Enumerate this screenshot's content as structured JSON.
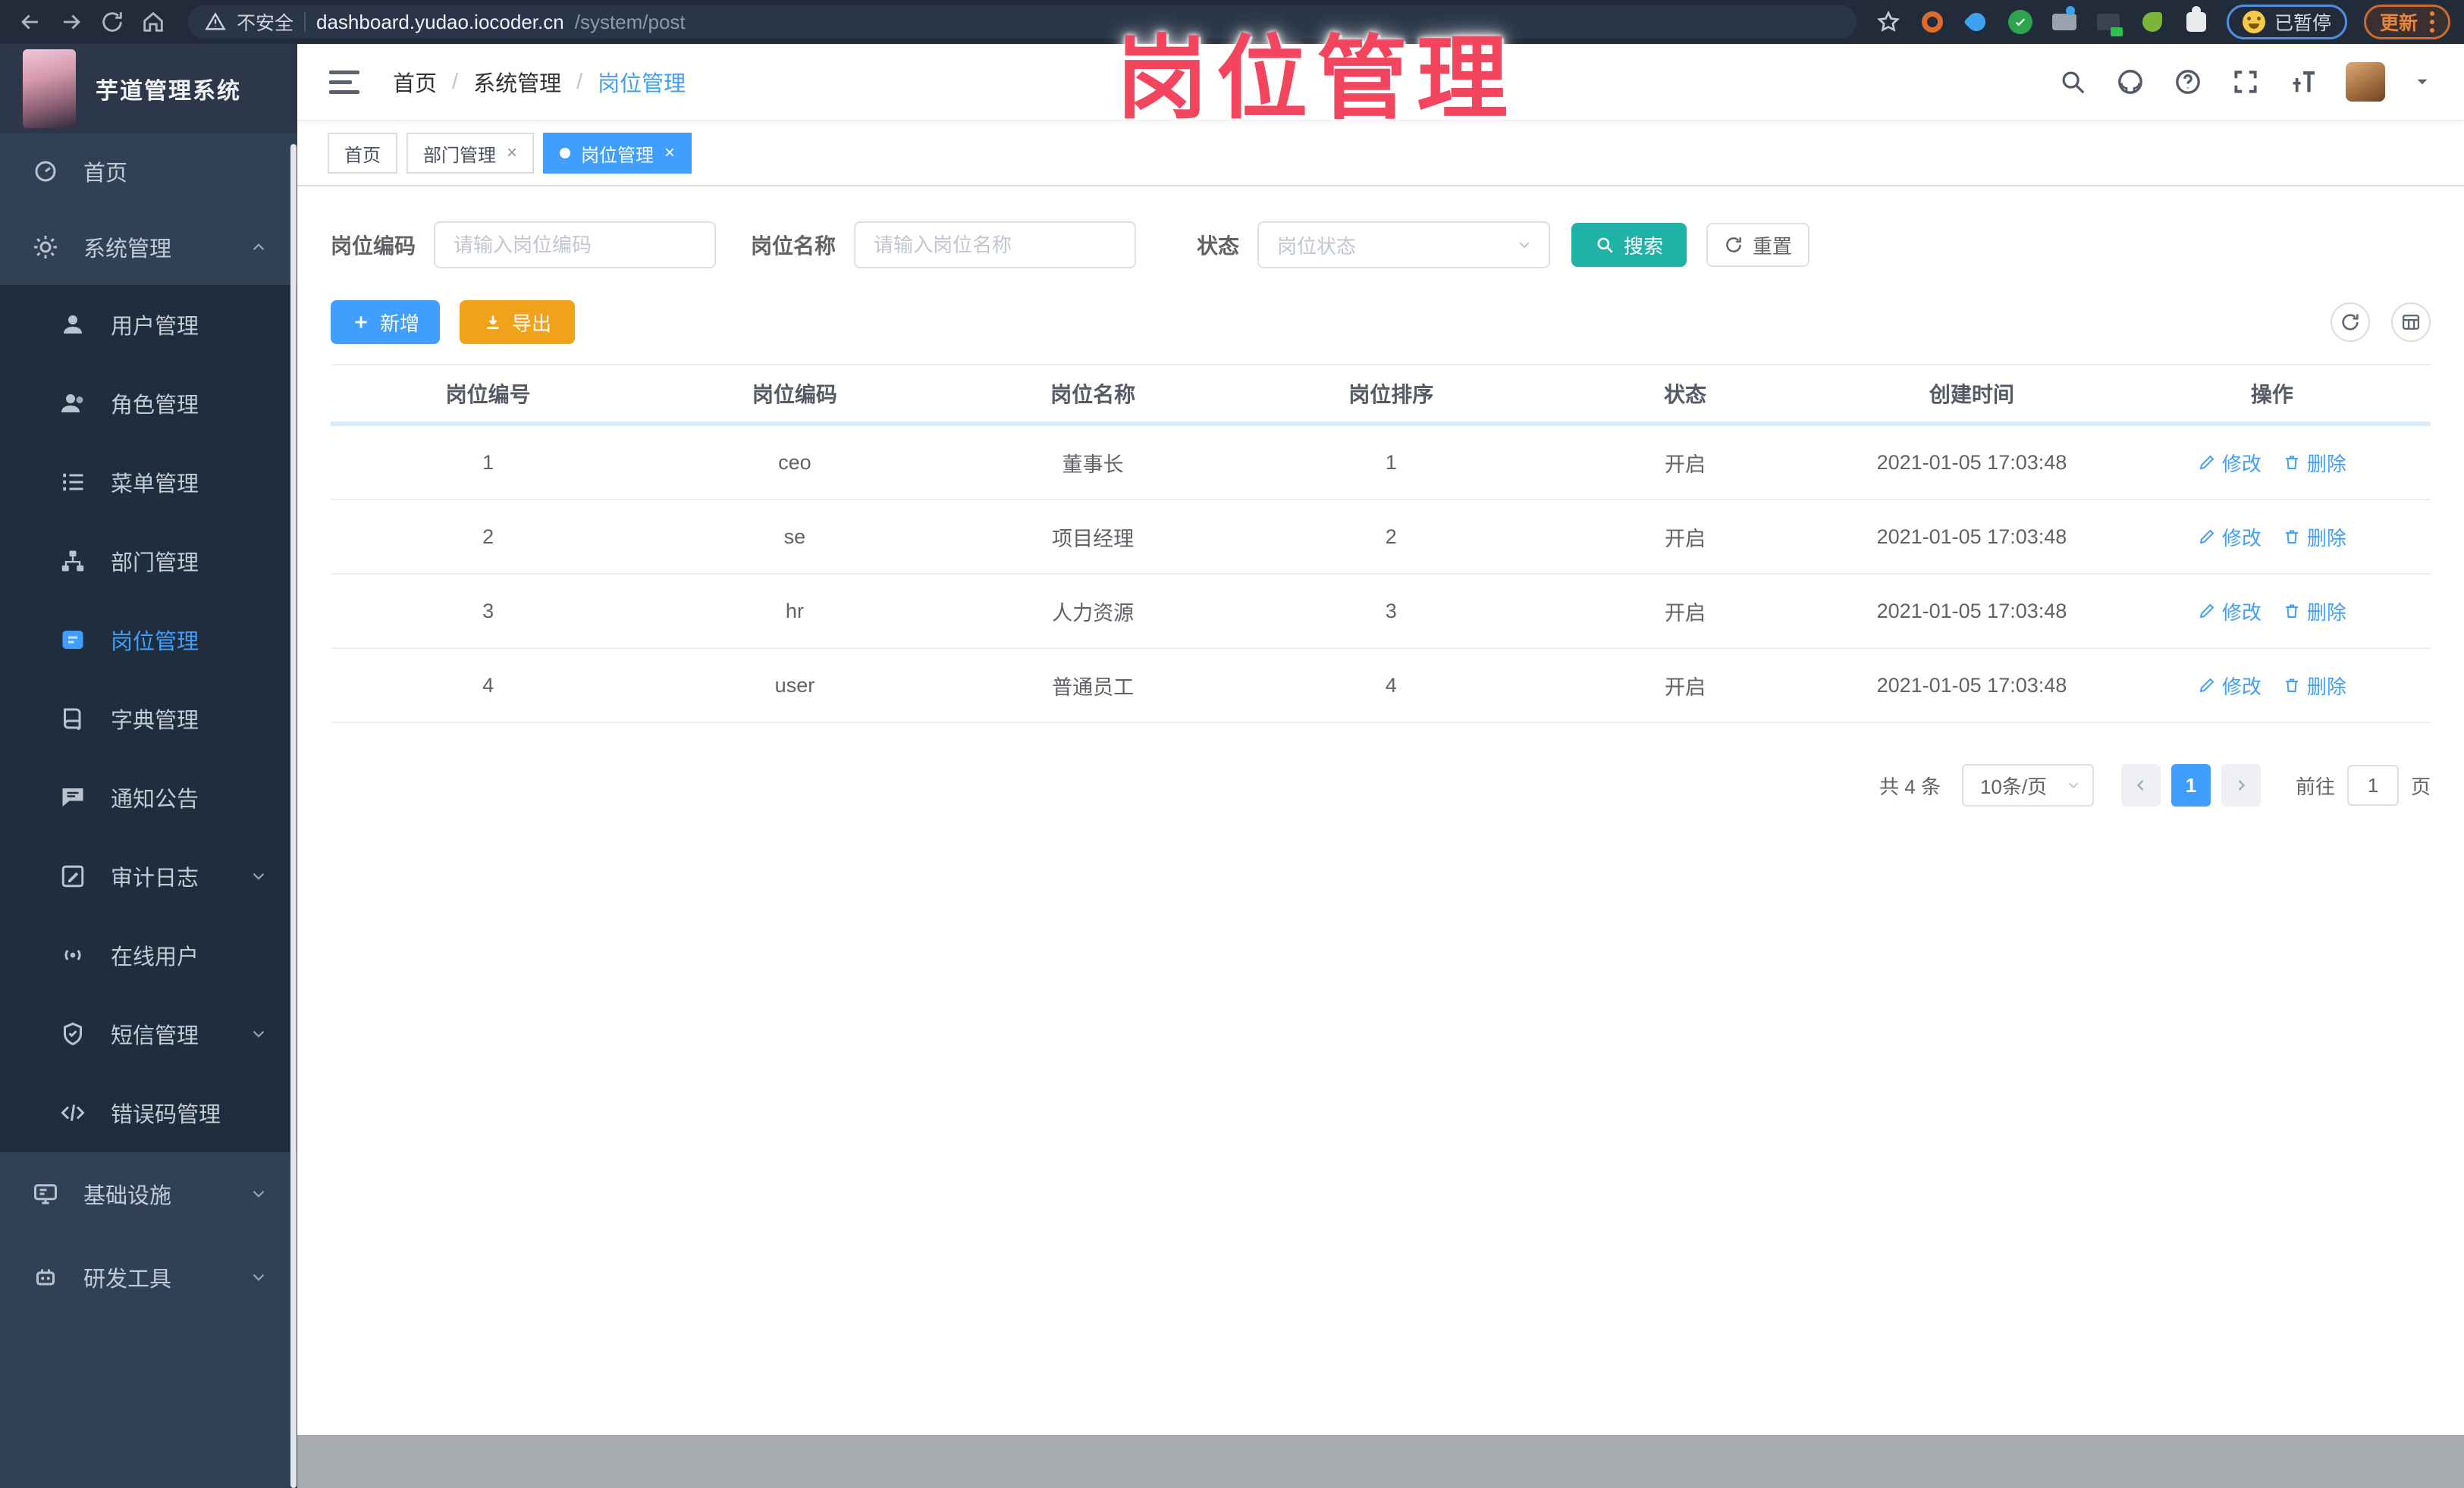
{
  "overlay": {
    "title": "岗位管理"
  },
  "colors": {
    "accent_blue": "#409eff",
    "search_teal": "#1fb2a6",
    "export_orange": "#f0a31a",
    "overlay_pink": "#f3465e",
    "sidebar_bg": "#304156",
    "submenu_bg": "#1f2d3d",
    "chrome_bg": "#212b3a"
  },
  "browser": {
    "security_label": "不安全",
    "url_host": "dashboard.yudao.iocoder.cn",
    "url_path": "/system/post",
    "paused_label": "已暂停",
    "update_label": "更新"
  },
  "sidebar": {
    "app_title": "芋道管理系统",
    "items": [
      {
        "label": "首页",
        "icon": "dashboard-icon",
        "level": 1
      },
      {
        "label": "系统管理",
        "icon": "gear-icon",
        "level": 1,
        "arrow": "up",
        "expanded": true
      },
      {
        "label": "用户管理",
        "icon": "user-icon",
        "level": 2
      },
      {
        "label": "角色管理",
        "icon": "role-icon",
        "level": 2
      },
      {
        "label": "菜单管理",
        "icon": "menu-list-icon",
        "level": 2
      },
      {
        "label": "部门管理",
        "icon": "dept-tree-icon",
        "level": 2
      },
      {
        "label": "岗位管理",
        "icon": "post-icon",
        "level": 2,
        "active": true
      },
      {
        "label": "字典管理",
        "icon": "dict-icon",
        "level": 2
      },
      {
        "label": "通知公告",
        "icon": "notice-icon",
        "level": 2
      },
      {
        "label": "审计日志",
        "icon": "audit-log-icon",
        "level": 2,
        "arrow": "down"
      },
      {
        "label": "在线用户",
        "icon": "online-user-icon",
        "level": 2
      },
      {
        "label": "短信管理",
        "icon": "sms-icon",
        "level": 2,
        "arrow": "down"
      },
      {
        "label": "错误码管理",
        "icon": "error-code-icon",
        "level": 2
      },
      {
        "label": "基础设施",
        "icon": "infra-icon",
        "level": 1,
        "arrow": "down"
      },
      {
        "label": "研发工具",
        "icon": "devtools-icon",
        "level": 1,
        "arrow": "down"
      }
    ]
  },
  "header": {
    "breadcrumb": [
      "首页",
      "系统管理",
      "岗位管理"
    ],
    "breadcrumb_sep": "/"
  },
  "tabs": [
    {
      "label": "首页",
      "closable": false,
      "active": false
    },
    {
      "label": "部门管理",
      "closable": true,
      "active": false
    },
    {
      "label": "岗位管理",
      "closable": true,
      "active": true
    }
  ],
  "tab_close_glyph": "×",
  "filters": {
    "post_code_label": "岗位编码",
    "post_code_placeholder": "请输入岗位编码",
    "post_name_label": "岗位名称",
    "post_name_placeholder": "请输入岗位名称",
    "status_label": "状态",
    "status_placeholder": "岗位状态",
    "search_label": "搜索",
    "reset_label": "重置"
  },
  "toolbar": {
    "add_label": "新增",
    "export_label": "导出"
  },
  "table": {
    "columns": [
      "岗位编号",
      "岗位编码",
      "岗位名称",
      "岗位排序",
      "状态",
      "创建时间",
      "操作"
    ],
    "edit_label": "修改",
    "delete_label": "删除",
    "rows": [
      {
        "id": "1",
        "code": "ceo",
        "name": "董事长",
        "sort": "1",
        "status": "开启",
        "created": "2021-01-05 17:03:48"
      },
      {
        "id": "2",
        "code": "se",
        "name": "项目经理",
        "sort": "2",
        "status": "开启",
        "created": "2021-01-05 17:03:48"
      },
      {
        "id": "3",
        "code": "hr",
        "name": "人力资源",
        "sort": "3",
        "status": "开启",
        "created": "2021-01-05 17:03:48"
      },
      {
        "id": "4",
        "code": "user",
        "name": "普通员工",
        "sort": "4",
        "status": "开启",
        "created": "2021-01-05 17:03:48"
      }
    ]
  },
  "pagination": {
    "total_text": "共 4 条",
    "page_size": "10条/页",
    "current_page": "1",
    "goto_label": "前往",
    "goto_value": "1",
    "page_suffix": "页"
  }
}
